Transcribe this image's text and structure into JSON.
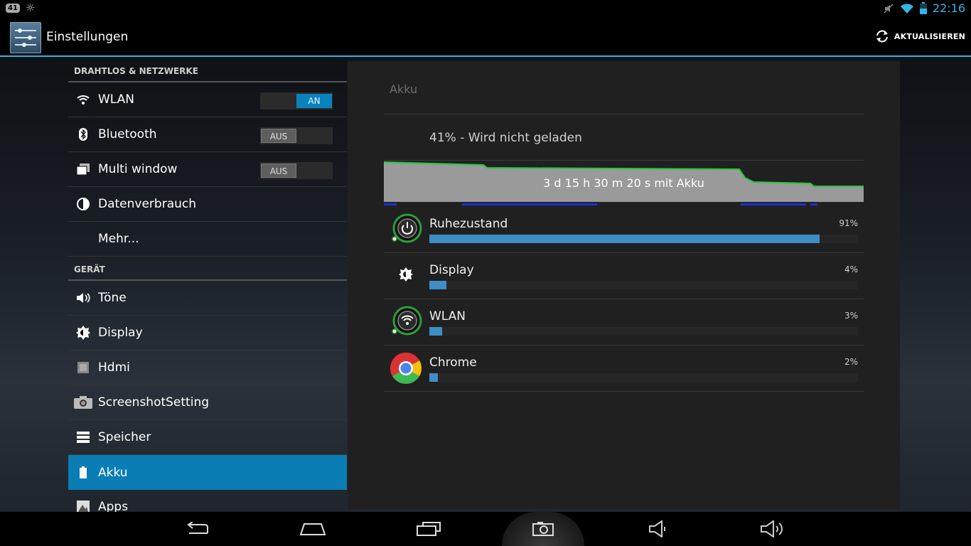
{
  "status_bar": {
    "notification_badge": "41",
    "time": "22:16",
    "icons": [
      "notification-badge-icon",
      "brightness-icon",
      "mute-icon",
      "wifi-icon",
      "battery-icon"
    ]
  },
  "action_bar": {
    "title": "Einstellungen",
    "refresh_label": "AKTUALISIEREN",
    "accent_color": "#33b5e5"
  },
  "sidebar": {
    "sections": [
      {
        "header": "DRAHTLOS & NETZWERKE",
        "items": [
          {
            "label": "WLAN",
            "icon": "wifi-icon",
            "toggle": "AN"
          },
          {
            "label": "Bluetooth",
            "icon": "bluetooth-icon",
            "toggle": "AUS"
          },
          {
            "label": "Multi window",
            "icon": "multi-window-icon",
            "toggle": "AUS"
          },
          {
            "label": "Datenverbrauch",
            "icon": "data-usage-icon"
          },
          {
            "label": "Mehr..."
          }
        ]
      },
      {
        "header": "GERÄT",
        "items": [
          {
            "label": "Töne",
            "icon": "sound-icon"
          },
          {
            "label": "Display",
            "icon": "display-icon"
          },
          {
            "label": "Hdmi",
            "icon": "hdmi-icon"
          },
          {
            "label": "ScreenshotSetting",
            "icon": "camera-icon"
          },
          {
            "label": "Speicher",
            "icon": "storage-icon"
          },
          {
            "label": "Akku",
            "icon": "battery-icon",
            "selected": true
          },
          {
            "label": "Apps",
            "icon": "apps-icon"
          }
        ]
      }
    ],
    "selected_color": "#0a7db4"
  },
  "battery_panel": {
    "title": "Akku",
    "status": "41% - Wird nicht geladen",
    "graph_label": "3 d 15 h 30 m 20 s mit Akku",
    "usage": [
      {
        "name": "Ruhezustand",
        "percent_label": "91%",
        "value": 91,
        "icon": "power-icon"
      },
      {
        "name": "Display",
        "percent_label": "4%",
        "value": 4,
        "icon": "display-icon"
      },
      {
        "name": "WLAN",
        "percent_label": "3%",
        "value": 3,
        "icon": "wifi-icon"
      },
      {
        "name": "Chrome",
        "percent_label": "2%",
        "value": 2,
        "icon": "chrome-icon"
      }
    ],
    "bar_color": "#3f8dc5"
  },
  "navigation_bar": {
    "buttons": [
      "back-icon",
      "home-icon",
      "recents-icon",
      "screenshot-icon",
      "volume-down-icon",
      "volume-up-icon"
    ]
  }
}
